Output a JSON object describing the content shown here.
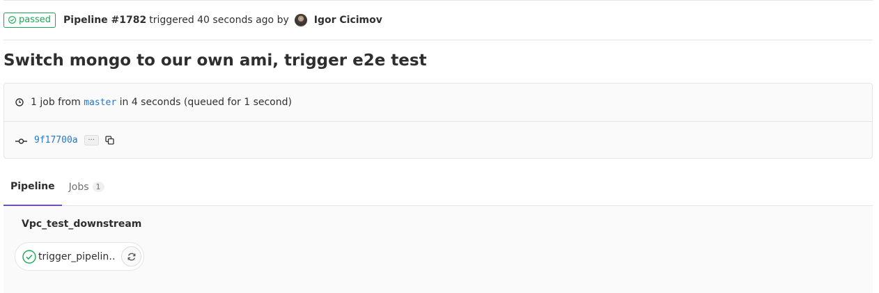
{
  "header": {
    "status_label": "passed",
    "pipeline_label": "Pipeline #1782",
    "triggered_text": "triggered 40 seconds ago by",
    "user_name": "Igor Cicimov",
    "status_color": "#1aaa55",
    "status_icon": "check-circle-icon"
  },
  "title": "Switch mongo to our own ami, trigger e2e test",
  "info": {
    "clock_icon": "clock-icon",
    "jobs_text_prefix": "1 job from",
    "branch": "master",
    "jobs_text_suffix": "in 4 seconds (queued for 1 second)",
    "commit_icon": "commit-icon",
    "commit_sha": "9f17700a",
    "ellipsis_label": "···",
    "copy_icon": "copy-icon"
  },
  "tabs": [
    {
      "label": "Pipeline",
      "active": true
    },
    {
      "label": "Jobs",
      "count": "1",
      "active": false
    }
  ],
  "pipeline": {
    "stage_title": "Vpc_test_downstream",
    "job": {
      "name": "trigger_pipelin…",
      "status_icon": "check-circle-icon",
      "action_icon": "retry-icon"
    }
  },
  "colors": {
    "success": "#1aaa55",
    "link": "#1f78d1",
    "active_tab": "#6b4fbb"
  }
}
